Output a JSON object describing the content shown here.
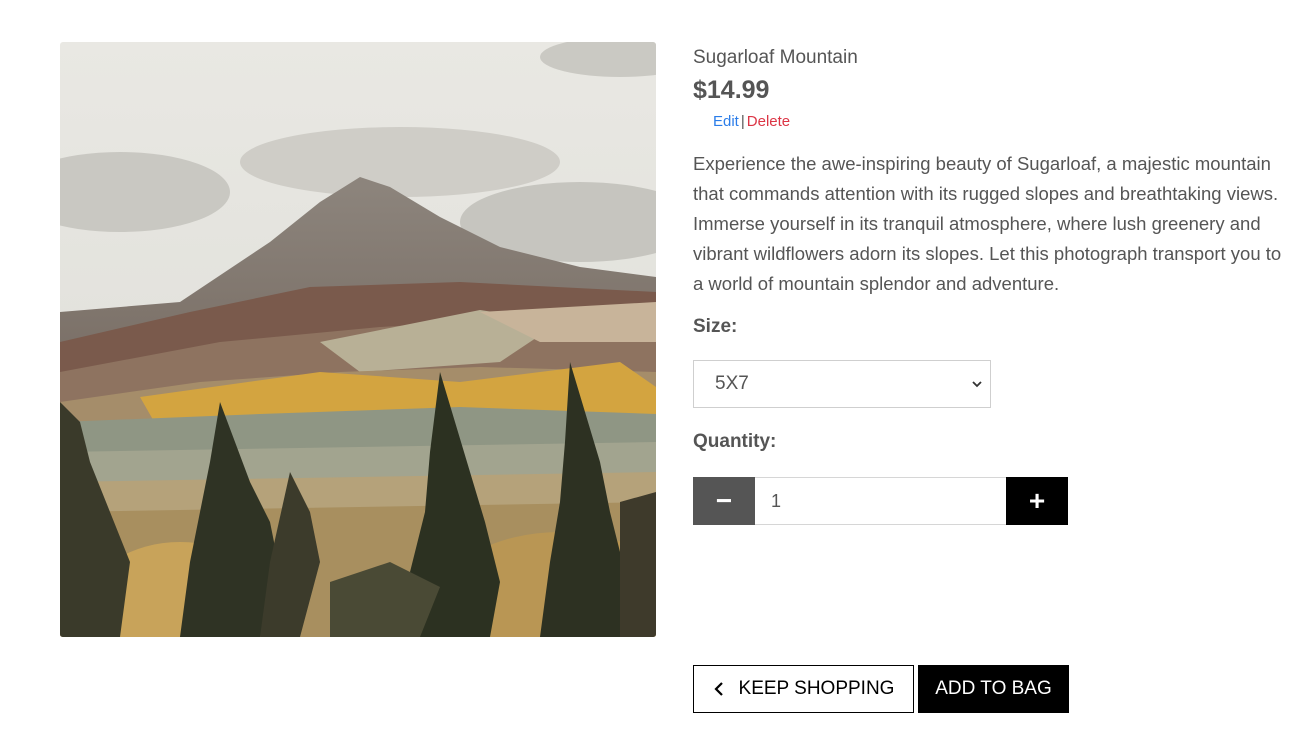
{
  "product": {
    "name": "Sugarloaf Mountain",
    "price": "$14.99",
    "edit_label": "Edit",
    "separator": "|",
    "delete_label": "Delete",
    "description": "Experience the awe-inspiring beauty of Sugarloaf, a majestic mountain that commands attention with its rugged slopes and breathtaking views. Immerse yourself in its tranquil atmosphere, where lush greenery and vibrant wildflowers adorn its slopes. Let this photograph transport you to a world of mountain splendor and adventure."
  },
  "size": {
    "label": "Size:",
    "selected": "5X7",
    "icon": "chevron-down-icon"
  },
  "quantity": {
    "label": "Quantity:",
    "value": "1",
    "decrement_symbol": "−",
    "increment_symbol": "+"
  },
  "actions": {
    "keep_shopping_label": "KEEP SHOPPING",
    "keep_shopping_icon": "chevron-left-icon",
    "add_to_bag_label": "ADD TO BAG"
  },
  "colors": {
    "link": "#2b7de9",
    "delete": "#dc3545",
    "text": "#555555",
    "primary_button": "#000000",
    "minus_button": "#555555"
  }
}
